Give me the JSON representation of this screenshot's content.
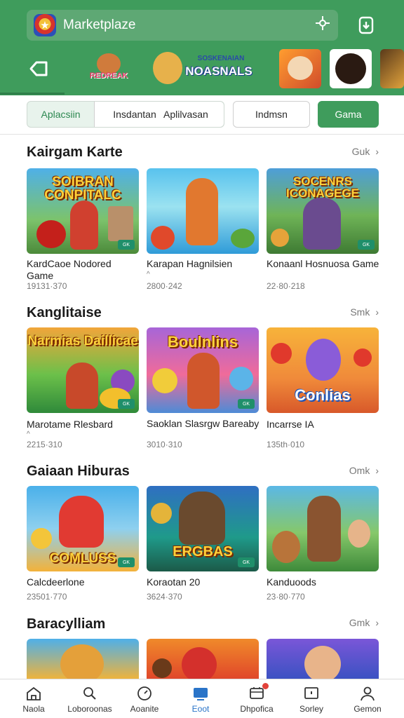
{
  "header": {
    "title": "Marketplaze",
    "logo_icon": "game-logo-icon",
    "tool_icon": "compass-icon",
    "right_button_icon": "download-icon",
    "accent": "#3f9c5c"
  },
  "banner_strip": {
    "back_icon": "back-arrow-icon",
    "items": [
      {
        "label": "REDREAK"
      },
      {
        "label": "NOASNALS",
        "sublabel": "SOSKENAIAN"
      },
      {
        "label": ""
      },
      {
        "label": ""
      },
      {
        "label": ""
      }
    ]
  },
  "tabs": [
    {
      "label": "Aplacsiin"
    },
    {
      "label": "Insdantan"
    },
    {
      "label": "Aplilvasan"
    },
    {
      "label": "Indmsn"
    },
    {
      "label": "Gama"
    }
  ],
  "sections": [
    {
      "title": "Kairgam Karte",
      "see_all": "Guk",
      "cards": [
        {
          "name": "KardCaoe Nodored Game",
          "meta": "19131·370",
          "art_title": "SOIBRAN CONPITALC",
          "tag": "GK"
        },
        {
          "name": "Karapan Hagnilsien",
          "sub": "^",
          "meta": "2800·242",
          "art_title": "",
          "tag": ""
        },
        {
          "name": "Konaanl Hosnuosa Game",
          "meta": "22·80·218",
          "art_title": "SOCENRS ICONAGEGE",
          "tag": "GK"
        }
      ]
    },
    {
      "title": "Kanglitaise",
      "see_all": "Smk",
      "cards": [
        {
          "name": "Marotame Rlesbard",
          "sub": "^",
          "meta": "2215·310",
          "art_title": "Narmias Daillicae",
          "tag": "GK"
        },
        {
          "name": "Saoklan Slasrgw Bareaby",
          "meta": "3010·310",
          "art_title": "Boulnlins",
          "tag": "GK"
        },
        {
          "name": "Incarrse IA",
          "meta": "135th·010",
          "art_title": "Conlias",
          "tag": ""
        }
      ]
    },
    {
      "title": "Gaiaan Hiburas",
      "see_all": "Omk",
      "cards": [
        {
          "name": "Calcdeerlone",
          "meta": "23501·770",
          "art_title": "COMLUSS",
          "tag": "GK"
        },
        {
          "name": "Koraotan 20",
          "meta": "3624·370",
          "art_title": "ERGBAS",
          "tag": "GK"
        },
        {
          "name": "Kanduoods",
          "meta": "23·80·770",
          "art_title": "",
          "tag": ""
        }
      ]
    },
    {
      "title": "Baracylliam",
      "see_all": "Gmk"
    }
  ],
  "bottom_nav": [
    {
      "label": "Naola",
      "icon": "home-icon"
    },
    {
      "label": "Loboroonas",
      "icon": "search-icon"
    },
    {
      "label": "Aoanite",
      "icon": "timer-icon"
    },
    {
      "label": "Eoot",
      "icon": "tv-icon",
      "active": true
    },
    {
      "label": "Dhpofica",
      "icon": "cart-icon",
      "badge": true
    },
    {
      "label": "Sorley",
      "icon": "display-icon"
    },
    {
      "label": "Gemon",
      "icon": "profile-icon"
    }
  ]
}
